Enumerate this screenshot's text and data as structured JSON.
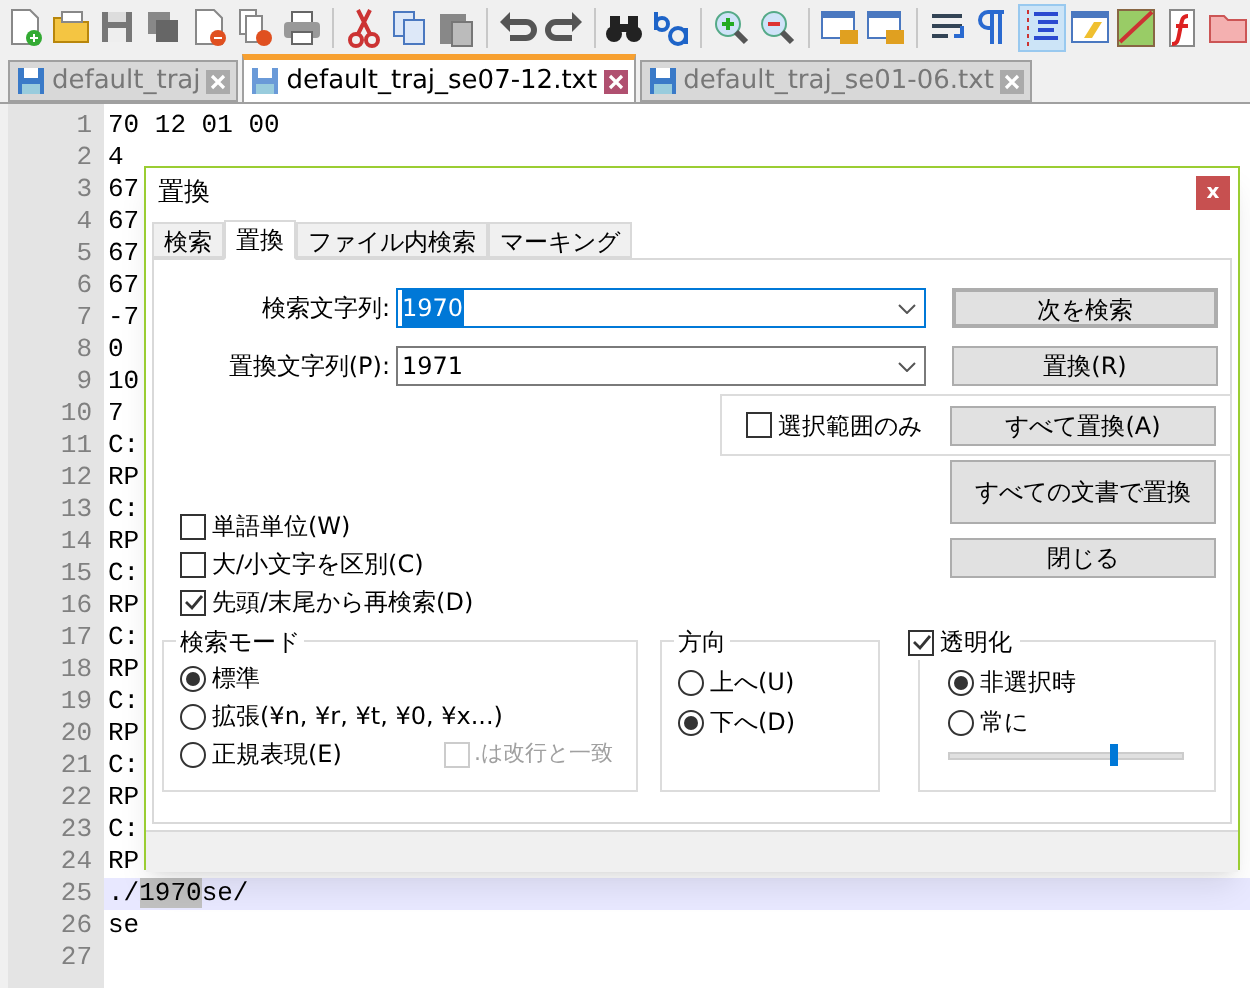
{
  "toolbar": {
    "items": [
      {
        "kind": "new-file"
      },
      {
        "kind": "open-folder"
      },
      {
        "kind": "save"
      },
      {
        "kind": "save-all"
      },
      {
        "kind": "close-file"
      },
      {
        "kind": "close-all"
      },
      {
        "kind": "print"
      },
      {
        "kind": "sep"
      },
      {
        "kind": "cut"
      },
      {
        "kind": "copy"
      },
      {
        "kind": "paste"
      },
      {
        "kind": "sep"
      },
      {
        "kind": "undo"
      },
      {
        "kind": "redo"
      },
      {
        "kind": "sep"
      },
      {
        "kind": "find"
      },
      {
        "kind": "replace"
      },
      {
        "kind": "sep"
      },
      {
        "kind": "zoom-in"
      },
      {
        "kind": "zoom-out"
      },
      {
        "kind": "sep"
      },
      {
        "kind": "lock-window"
      },
      {
        "kind": "lock-window"
      },
      {
        "kind": "sep"
      },
      {
        "kind": "wrap"
      },
      {
        "kind": "pilcrow"
      },
      {
        "kind": "indent-guide",
        "active": true
      },
      {
        "kind": "window"
      },
      {
        "kind": "map"
      },
      {
        "kind": "function"
      },
      {
        "kind": "folder"
      }
    ]
  },
  "file_tabs": [
    {
      "label": "default_traj",
      "selected": false
    },
    {
      "label": "default_traj_se07-12.txt",
      "selected": true
    },
    {
      "label": "default_traj_se01-06.txt",
      "selected": false
    }
  ],
  "editor": {
    "lines": [
      {
        "number": "1",
        "current": false,
        "segments": [
          {
            "text": "70 12 01 00",
            "highlighted": false
          }
        ]
      },
      {
        "number": "2",
        "current": false,
        "segments": [
          {
            "text": "4",
            "highlighted": false
          }
        ]
      },
      {
        "number": "3",
        "current": false,
        "segments": [
          {
            "text": "67",
            "highlighted": false
          }
        ]
      },
      {
        "number": "4",
        "current": false,
        "segments": [
          {
            "text": "67",
            "highlighted": false
          }
        ]
      },
      {
        "number": "5",
        "current": false,
        "segments": [
          {
            "text": "67",
            "highlighted": false
          }
        ]
      },
      {
        "number": "6",
        "current": false,
        "segments": [
          {
            "text": "67",
            "highlighted": false
          }
        ]
      },
      {
        "number": "7",
        "current": false,
        "segments": [
          {
            "text": "-7",
            "highlighted": false
          }
        ]
      },
      {
        "number": "8",
        "current": false,
        "segments": [
          {
            "text": "0",
            "highlighted": false
          }
        ]
      },
      {
        "number": "9",
        "current": false,
        "segments": [
          {
            "text": "10",
            "highlighted": false
          }
        ]
      },
      {
        "number": "10",
        "current": false,
        "segments": [
          {
            "text": "7",
            "highlighted": false
          }
        ]
      },
      {
        "number": "11",
        "current": false,
        "segments": [
          {
            "text": "C:",
            "highlighted": false
          }
        ]
      },
      {
        "number": "12",
        "current": false,
        "segments": [
          {
            "text": "RP",
            "highlighted": false
          }
        ]
      },
      {
        "number": "13",
        "current": false,
        "segments": [
          {
            "text": "C:",
            "highlighted": false
          }
        ]
      },
      {
        "number": "14",
        "current": false,
        "segments": [
          {
            "text": "RP",
            "highlighted": false
          }
        ]
      },
      {
        "number": "15",
        "current": false,
        "segments": [
          {
            "text": "C:",
            "highlighted": false
          }
        ]
      },
      {
        "number": "16",
        "current": false,
        "segments": [
          {
            "text": "RP",
            "highlighted": false
          }
        ]
      },
      {
        "number": "17",
        "current": false,
        "segments": [
          {
            "text": "C:",
            "highlighted": false
          }
        ]
      },
      {
        "number": "18",
        "current": false,
        "segments": [
          {
            "text": "RP",
            "highlighted": false
          }
        ]
      },
      {
        "number": "19",
        "current": false,
        "segments": [
          {
            "text": "C:",
            "highlighted": false
          }
        ]
      },
      {
        "number": "20",
        "current": false,
        "segments": [
          {
            "text": "RP",
            "highlighted": false
          }
        ]
      },
      {
        "number": "21",
        "current": false,
        "segments": [
          {
            "text": "C:",
            "highlighted": false
          }
        ]
      },
      {
        "number": "22",
        "current": false,
        "segments": [
          {
            "text": "RP",
            "highlighted": false
          }
        ]
      },
      {
        "number": "23",
        "current": false,
        "segments": [
          {
            "text": "C:",
            "highlighted": false
          }
        ]
      },
      {
        "number": "24",
        "current": false,
        "segments": [
          {
            "text": "RP",
            "highlighted": false
          }
        ]
      },
      {
        "number": "25",
        "current": true,
        "segments": [
          {
            "text": "./",
            "highlighted": false
          },
          {
            "text": "1970",
            "highlighted": true
          },
          {
            "text": "se/",
            "highlighted": false
          }
        ]
      },
      {
        "number": "26",
        "current": false,
        "segments": [
          {
            "text": "se",
            "highlighted": false
          }
        ]
      },
      {
        "number": "27",
        "current": false
      }
    ]
  },
  "dialog": {
    "title": "置換",
    "close": "x",
    "tabs": [
      {
        "label": "検索",
        "selected": false
      },
      {
        "label": "置換",
        "selected": true
      },
      {
        "label": "ファイル内検索",
        "selected": false
      },
      {
        "label": "マーキング",
        "selected": false
      }
    ],
    "find_field": {
      "label": "検索文字列:",
      "value": "1970"
    },
    "replace_field": {
      "label": "置換文字列(P):",
      "value": "1971"
    },
    "in_selection": {
      "label": "選択範囲のみ",
      "checked": false
    },
    "buttons": {
      "find_next": "次を検索",
      "replace": "置換(R)",
      "replace_all": "すべて置換(A)",
      "replace_all_docs": "すべての文書で置換",
      "close": "閉じる"
    },
    "options": [
      {
        "label": "単語単位(W)",
        "checked": false
      },
      {
        "label": "大/小文字を区別(C)",
        "checked": false
      },
      {
        "label": "先頭/末尾から再検索(D)",
        "checked": true
      }
    ],
    "search_mode": {
      "title": "検索モード",
      "options": [
        {
          "label": "標準",
          "selected": true
        },
        {
          "label": "拡張(¥n, ¥r, ¥t, ¥0, ¥x...)",
          "selected": false
        },
        {
          "label": "正規表現(E)",
          "selected": false
        }
      ],
      "dot_newline": {
        "label": ".は改行と一致",
        "checked": false,
        "disabled": true
      }
    },
    "direction": {
      "title": "方向",
      "options": [
        {
          "label": "上へ(U)",
          "selected": false
        },
        {
          "label": "下へ(D)",
          "selected": true
        }
      ]
    },
    "transparency": {
      "label": "透明化",
      "checked": true,
      "options": [
        {
          "label": "非選択時",
          "selected": true
        },
        {
          "label": "常に",
          "selected": false
        }
      ],
      "level": 0.7
    }
  }
}
